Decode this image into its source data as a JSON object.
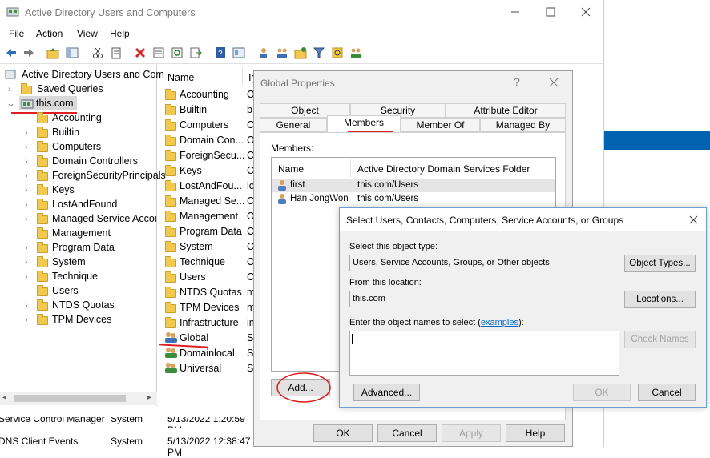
{
  "window": {
    "title": "Active Directory Users and Computers"
  },
  "menu": [
    "File",
    "Action",
    "View",
    "Help"
  ],
  "tree": {
    "root": "Active Directory Users and Com",
    "saved_queries": "Saved Queries",
    "domain": "this.com",
    "children": [
      "Accounting",
      "Builtin",
      "Computers",
      "Domain Controllers",
      "ForeignSecurityPrincipals",
      "Keys",
      "LostAndFound",
      "Managed Service Accour",
      "Management",
      "Program Data",
      "System",
      "Technique",
      "Users",
      "NTDS Quotas",
      "TPM Devices"
    ]
  },
  "list": {
    "col_name": "Name",
    "col_type": "Ty",
    "items": [
      {
        "name": "Accounting",
        "t": "O"
      },
      {
        "name": "Builtin",
        "t": "b"
      },
      {
        "name": "Computers",
        "t": "C"
      },
      {
        "name": "Domain Con...",
        "t": "O"
      },
      {
        "name": "ForeignSecu...",
        "t": "C"
      },
      {
        "name": "Keys",
        "t": "C"
      },
      {
        "name": "LostAndFou...",
        "t": "lo"
      },
      {
        "name": "Managed Se...",
        "t": "C"
      },
      {
        "name": "Management",
        "t": "O"
      },
      {
        "name": "Program Data",
        "t": "C"
      },
      {
        "name": "System",
        "t": "C"
      },
      {
        "name": "Technique",
        "t": "O"
      },
      {
        "name": "Users",
        "t": "C"
      },
      {
        "name": "NTDS Quotas",
        "t": "m"
      },
      {
        "name": "TPM Devices",
        "t": "m"
      },
      {
        "name": "Infrastructure",
        "t": "in"
      },
      {
        "name": "Global",
        "t": "S"
      },
      {
        "name": "Domainlocal",
        "t": "S"
      },
      {
        "name": "Universal",
        "t": "S"
      }
    ]
  },
  "bottom_rows": [
    {
      "source": "Service Control Manager",
      "cat": "System",
      "date": "5/13/2022 1:20:59 PM"
    },
    {
      "source": "DNS Client Events",
      "cat": "System",
      "date": "5/13/2022 12:38:47 PM"
    }
  ],
  "global_props": {
    "title": "Global Properties",
    "help": "?",
    "tabs_top": [
      "Object",
      "Security",
      "Attribute Editor"
    ],
    "tabs_bottom": [
      "General",
      "Members",
      "Member Of",
      "Managed By"
    ],
    "members_label": "Members:",
    "col_name": "Name",
    "col_folder": "Active Directory Domain Services Folder",
    "members": [
      {
        "name": "first",
        "folder": "this.com/Users"
      },
      {
        "name": "Han JongWon",
        "folder": "this.com/Users"
      }
    ],
    "add": "Add...",
    "ok": "OK",
    "cancel": "Cancel",
    "apply": "Apply",
    "help_btn": "Help"
  },
  "select_dialog": {
    "title": "Select Users, Contacts, Computers, Service Accounts, or Groups",
    "object_type_label": "Select this object type:",
    "object_type_value": "Users, Service Accounts, Groups, or Other objects",
    "object_types_btn": "Object Types...",
    "location_label": "From this location:",
    "location_value": "this.com",
    "locations_btn": "Locations...",
    "enter_label_pre": "Enter the object names to select (",
    "enter_label_link": "examples",
    "enter_label_post": "):",
    "input_value": "",
    "check_names": "Check Names",
    "advanced": "Advanced...",
    "ok": "OK",
    "cancel": "Cancel"
  },
  "accent": "#0078d7",
  "annotation_color": "#e02020"
}
